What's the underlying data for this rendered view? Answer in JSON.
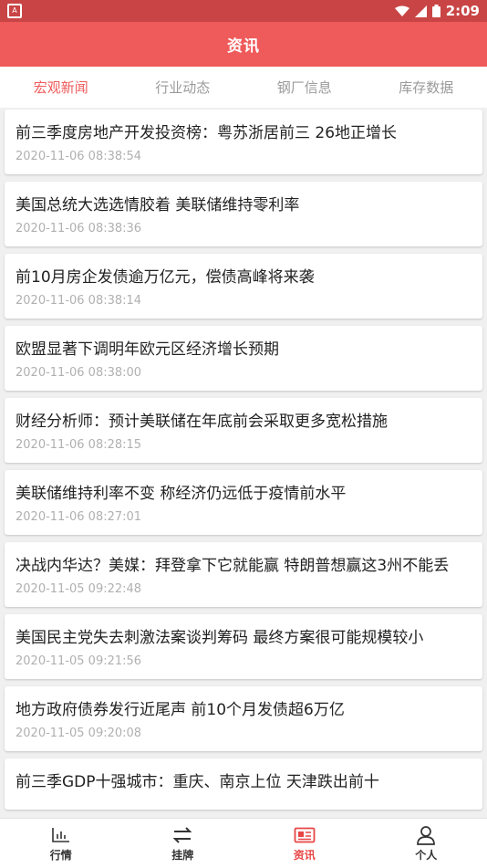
{
  "status_bar": {
    "time": "2:09"
  },
  "header": {
    "title": "资讯"
  },
  "tabs": [
    {
      "label": "宏观新闻",
      "active": true
    },
    {
      "label": "行业动态",
      "active": false
    },
    {
      "label": "钢厂信息",
      "active": false
    },
    {
      "label": "库存数据",
      "active": false
    }
  ],
  "news": [
    {
      "title": "前三季度房地产开发投资榜：粤苏浙居前三 26地正增长",
      "time": "2020-11-06 08:38:54"
    },
    {
      "title": "美国总统大选选情胶着 美联储维持零利率",
      "time": "2020-11-06 08:38:36"
    },
    {
      "title": "前10月房企发债逾万亿元，偿债高峰将来袭",
      "time": "2020-11-06 08:38:14"
    },
    {
      "title": "欧盟显著下调明年欧元区经济增长预期",
      "time": "2020-11-06 08:38:00"
    },
    {
      "title": "财经分析师：预计美联储在年底前会采取更多宽松措施",
      "time": "2020-11-06 08:28:15"
    },
    {
      "title": "美联储维持利率不变 称经济仍远低于疫情前水平",
      "time": "2020-11-06 08:27:01"
    },
    {
      "title": "决战内华达？美媒：拜登拿下它就能赢 特朗普想赢这3州不能丢",
      "time": "2020-11-05 09:22:48"
    },
    {
      "title": "美国民主党失去刺激法案谈判筹码 最终方案很可能规模较小",
      "time": "2020-11-05 09:21:56"
    },
    {
      "title": "地方政府债券发行近尾声 前10个月发债超6万亿",
      "time": "2020-11-05 09:20:08"
    },
    {
      "title": "前三季GDP十强城市：重庆、南京上位 天津跌出前十",
      "time": ""
    }
  ],
  "bottom_nav": [
    {
      "label": "行情",
      "icon": "chart-icon",
      "active": false
    },
    {
      "label": "挂牌",
      "icon": "swap-icon",
      "active": false
    },
    {
      "label": "资讯",
      "icon": "news-icon",
      "active": true
    },
    {
      "label": "个人",
      "icon": "person-icon",
      "active": false
    }
  ],
  "colors": {
    "primary": "#ef5a5a",
    "status_bar": "#c94545",
    "inactive_tab": "#9a9a9a",
    "time_text": "#b0b0b0"
  }
}
